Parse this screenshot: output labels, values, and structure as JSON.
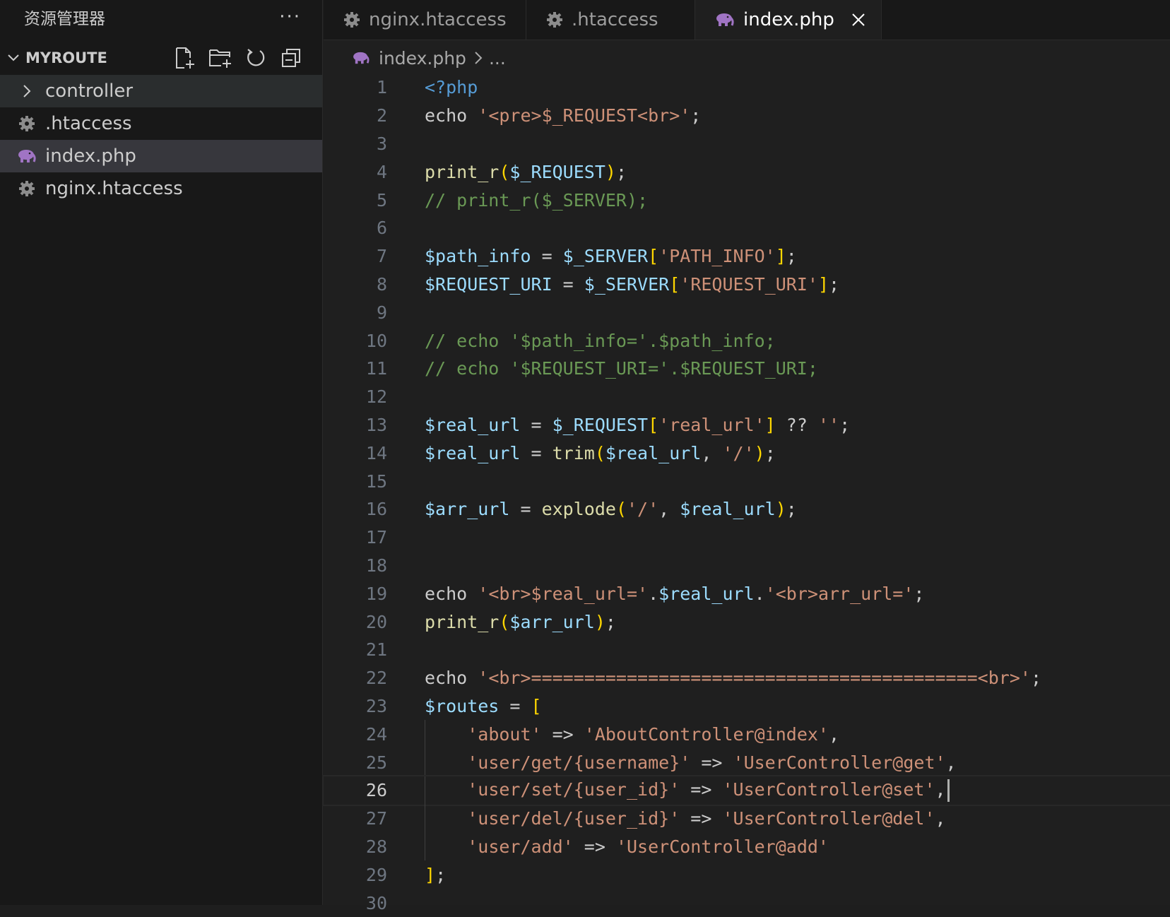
{
  "explorer": {
    "title": "资源管理器",
    "more": "···",
    "project": "MYROUTE",
    "items": [
      {
        "label": "controller",
        "type": "folder",
        "icon": "chevron-right-icon"
      },
      {
        "label": ".htaccess",
        "type": "file",
        "icon": "gear-icon"
      },
      {
        "label": "index.php",
        "type": "file",
        "icon": "php-elephant-icon"
      },
      {
        "label": "nginx.htaccess",
        "type": "file",
        "icon": "gear-icon"
      }
    ]
  },
  "tabs": [
    {
      "label": "nginx.htaccess",
      "icon": "gear-icon",
      "active": false
    },
    {
      "label": ".htaccess",
      "icon": "gear-icon",
      "active": false
    },
    {
      "label": "index.php",
      "icon": "php-elephant-icon",
      "active": true
    }
  ],
  "breadcrumb": {
    "file": "index.php",
    "rest": "..."
  },
  "code": {
    "current_line": 26,
    "lines": [
      {
        "n": "1",
        "t": "<?php"
      },
      {
        "n": "2",
        "t": "echo '<pre>$_REQUEST<br>';"
      },
      {
        "n": "3",
        "t": ""
      },
      {
        "n": "4",
        "t": "print_r($_REQUEST);"
      },
      {
        "n": "5",
        "t": "// print_r($_SERVER);"
      },
      {
        "n": "6",
        "t": ""
      },
      {
        "n": "7",
        "t": "$path_info = $_SERVER['PATH_INFO'];"
      },
      {
        "n": "8",
        "t": "$REQUEST_URI = $_SERVER['REQUEST_URI'];"
      },
      {
        "n": "9",
        "t": ""
      },
      {
        "n": "10",
        "t": "// echo '$path_info='.$path_info;"
      },
      {
        "n": "11",
        "t": "// echo '$REQUEST_URI='.$REQUEST_URI;"
      },
      {
        "n": "12",
        "t": ""
      },
      {
        "n": "13",
        "t": "$real_url = $_REQUEST['real_url'] ?? '';"
      },
      {
        "n": "14",
        "t": "$real_url = trim($real_url, '/');"
      },
      {
        "n": "15",
        "t": ""
      },
      {
        "n": "16",
        "t": "$arr_url = explode('/', $real_url);"
      },
      {
        "n": "17",
        "t": ""
      },
      {
        "n": "18",
        "t": ""
      },
      {
        "n": "19",
        "t": "echo '<br>$real_url='.$real_url.'<br>arr_url=';"
      },
      {
        "n": "20",
        "t": "print_r($arr_url);"
      },
      {
        "n": "21",
        "t": ""
      },
      {
        "n": "22",
        "t": "echo '<br>==========================================<br>';"
      },
      {
        "n": "23",
        "t": "$routes = ["
      },
      {
        "n": "24",
        "t": "    'about' => 'AboutController@index',"
      },
      {
        "n": "25",
        "t": "    'user/get/{username}' => 'UserController@get',"
      },
      {
        "n": "26",
        "t": "    'user/set/{user_id}' => 'UserController@set',"
      },
      {
        "n": "27",
        "t": "    'user/del/{user_id}' => 'UserController@del',"
      },
      {
        "n": "28",
        "t": "    'user/add' => 'UserController@add'"
      },
      {
        "n": "29",
        "t": "];"
      },
      {
        "n": "30",
        "t": ""
      }
    ]
  }
}
